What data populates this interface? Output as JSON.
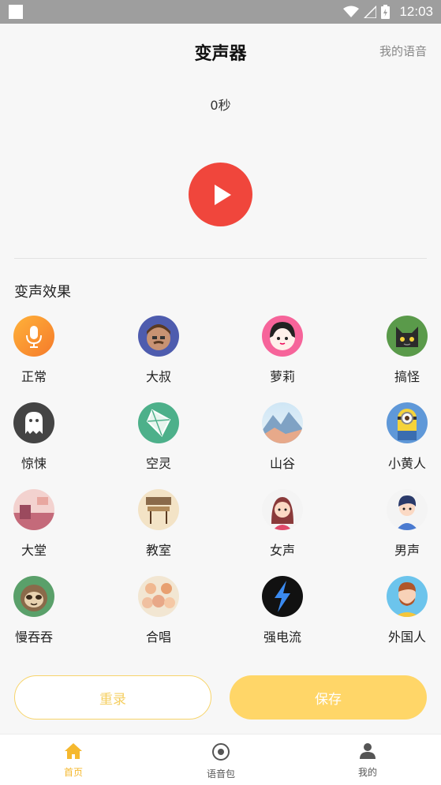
{
  "status_bar": {
    "time": "12:03"
  },
  "header": {
    "title": "变声器",
    "my_voice_link": "我的语音"
  },
  "recording": {
    "duration": "0秒"
  },
  "effects_section": {
    "title": "变声效果"
  },
  "effects": [
    {
      "label": "正常",
      "icon": "microphone-icon"
    },
    {
      "label": "大叔",
      "icon": "uncle-avatar-icon"
    },
    {
      "label": "萝莉",
      "icon": "girl-avatar-icon"
    },
    {
      "label": "搞怪",
      "icon": "cat-icon"
    },
    {
      "label": "惊悚",
      "icon": "ghost-icon"
    },
    {
      "label": "空灵",
      "icon": "kite-icon"
    },
    {
      "label": "山谷",
      "icon": "mountain-icon"
    },
    {
      "label": "小黄人",
      "icon": "minion-icon"
    },
    {
      "label": "大堂",
      "icon": "hall-icon"
    },
    {
      "label": "教室",
      "icon": "classroom-icon"
    },
    {
      "label": "女声",
      "icon": "woman-avatar-icon"
    },
    {
      "label": "男声",
      "icon": "man-avatar-icon"
    },
    {
      "label": "慢吞吞",
      "icon": "sloth-icon"
    },
    {
      "label": "合唱",
      "icon": "chorus-icon"
    },
    {
      "label": "强电流",
      "icon": "lightning-icon"
    },
    {
      "label": "外国人",
      "icon": "foreigner-avatar-icon"
    }
  ],
  "actions": {
    "rerecord": "重录",
    "save": "保存"
  },
  "tabs": [
    {
      "label": "首页",
      "icon": "home-icon",
      "active": true
    },
    {
      "label": "语音包",
      "icon": "voice-pack-icon",
      "active": false
    },
    {
      "label": "我的",
      "icon": "profile-icon",
      "active": false
    }
  ],
  "colors": {
    "accent": "#ffd668",
    "play": "#f0463c",
    "tab_active": "#f5b82e"
  }
}
